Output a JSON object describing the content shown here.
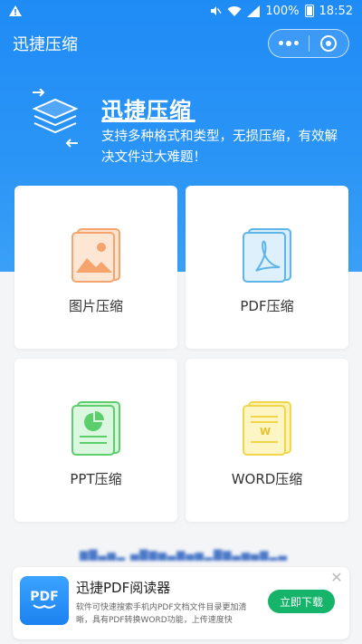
{
  "status_bar": {
    "battery_text": "100%",
    "time": "18:52",
    "icons": [
      "warning-icon",
      "mute-icon",
      "wifi-icon",
      "signal-icon",
      "battery-icon"
    ]
  },
  "navbar": {
    "title": "迅捷压缩",
    "menu_icon": "more-dots-icon",
    "close_icon": "target-icon"
  },
  "hero": {
    "title": "迅捷压缩",
    "description": "支持多种格式和类型，无损压缩，有效解决文件过大难题！"
  },
  "cards": [
    {
      "label": "图片压缩",
      "icon": "image-file-icon",
      "color": "#f4a46c"
    },
    {
      "label": "PDF压缩",
      "icon": "pdf-file-icon",
      "color": "#5fb4e8"
    },
    {
      "label": "PPT压缩",
      "icon": "ppt-file-icon",
      "color": "#5ccf6c"
    },
    {
      "label": "WORD压缩",
      "icon": "word-file-icon",
      "color": "#f2d64a"
    }
  ],
  "ad": {
    "logo_text": "PDF",
    "title": "迅捷PDF阅读器",
    "description": "软件可快速搜索手机内PDF文档文件目录更加清晰，具有PDF转换WORD功能，上传速度快",
    "button": "立即下载",
    "close": "✕"
  },
  "colors": {
    "primary": "#1f8bf5",
    "download_button": "#15b46a",
    "background": "#f4f5f7"
  }
}
